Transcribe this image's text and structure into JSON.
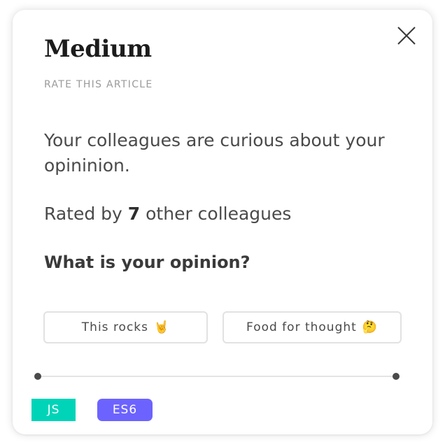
{
  "card": {
    "brand": "Medium",
    "subtitle": "RATE THIS ARTICLE",
    "prompt": "Your colleagues are curious about your opininion.",
    "rated": {
      "prefix": "Rated by",
      "count": "7",
      "suffix": "other colleagues"
    },
    "question": "What is your opinion?",
    "close_icon": "close-x-icon",
    "options": [
      {
        "label": "This rocks",
        "emoji": "🤘"
      },
      {
        "label": "Food for thought",
        "emoji": "🤔"
      }
    ],
    "tags": [
      {
        "label": "JS",
        "color": "#00d4b8"
      },
      {
        "label": "ES6",
        "color": "#6c63ff"
      }
    ]
  }
}
